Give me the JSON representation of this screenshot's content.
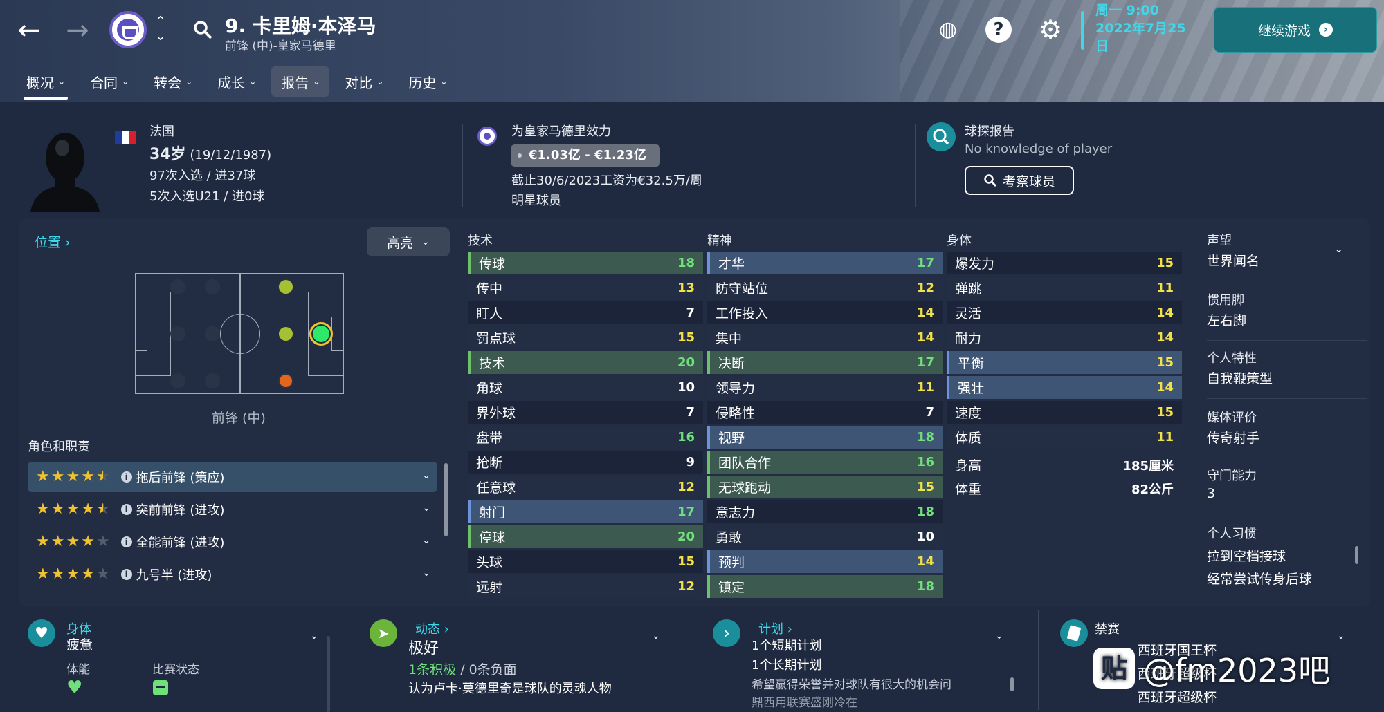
{
  "header": {
    "back_icon": "arrow-left-icon",
    "forward_icon": "arrow-right-icon",
    "player_name": "9. 卡里姆·本泽马",
    "player_sub": "前锋 (中)-皇家马德里",
    "date_day": "周一 9:00",
    "date_date": "2022年7月25",
    "date_suffix": "日",
    "continue_label": "继续游戏"
  },
  "tabs": [
    {
      "label": "概况"
    },
    {
      "label": "合同"
    },
    {
      "label": "转会"
    },
    {
      "label": "成长"
    },
    {
      "label": "报告"
    },
    {
      "label": "对比"
    },
    {
      "label": "历史"
    }
  ],
  "profile": {
    "nationality": "法国",
    "age": "34岁",
    "dob": "(19/12/1987)",
    "caps": "97次入选 / 进37球",
    "u21_caps": "5次入选U21 / 进0球",
    "club_status": "为皇家马德里效力",
    "value": "€1.03亿 - €1.23亿",
    "contract": "截止30/6/2023工资为€32.5万/周",
    "squad_status": "明星球员",
    "scout_title": "球探报告",
    "scout_text": "No knowledge of player",
    "scout_button": "考察球员",
    "flag_colors": [
      "#1f3e9c",
      "#ffffff",
      "#d6202c"
    ]
  },
  "position": {
    "link": "位置",
    "highlight": "高亮",
    "label": "前锋 (中)"
  },
  "roles": {
    "title": "角色和职责",
    "items": [
      {
        "stars": 4.5,
        "name": "拖后前锋 (策应)"
      },
      {
        "stars": 4.5,
        "name": "突前前锋 (进攻)"
      },
      {
        "stars": 4,
        "name": "全能前锋 (进攻)"
      },
      {
        "stars": 4,
        "name": "九号半 (进攻)"
      }
    ]
  },
  "attributes": {
    "technical": {
      "title": "技术",
      "items": [
        {
          "name": "传球",
          "value": "18",
          "hl": "g"
        },
        {
          "name": "传中",
          "value": "13",
          "hl": ""
        },
        {
          "name": "盯人",
          "value": "7",
          "hl": ""
        },
        {
          "name": "罚点球",
          "value": "15",
          "hl": ""
        },
        {
          "name": "技术",
          "value": "20",
          "hl": "g"
        },
        {
          "name": "角球",
          "value": "10",
          "hl": ""
        },
        {
          "name": "界外球",
          "value": "7",
          "hl": ""
        },
        {
          "name": "盘带",
          "value": "16",
          "hl": ""
        },
        {
          "name": "抢断",
          "value": "9",
          "hl": ""
        },
        {
          "name": "任意球",
          "value": "12",
          "hl": ""
        },
        {
          "name": "射门",
          "value": "17",
          "hl": "b"
        },
        {
          "name": "停球",
          "value": "20",
          "hl": "g"
        },
        {
          "name": "头球",
          "value": "15",
          "hl": ""
        },
        {
          "name": "远射",
          "value": "12",
          "hl": ""
        }
      ]
    },
    "mental": {
      "title": "精神",
      "items": [
        {
          "name": "才华",
          "value": "17",
          "hl": "b"
        },
        {
          "name": "防守站位",
          "value": "12",
          "hl": ""
        },
        {
          "name": "工作投入",
          "value": "14",
          "hl": ""
        },
        {
          "name": "集中",
          "value": "14",
          "hl": ""
        },
        {
          "name": "决断",
          "value": "17",
          "hl": "g"
        },
        {
          "name": "领导力",
          "value": "11",
          "hl": ""
        },
        {
          "name": "侵略性",
          "value": "7",
          "hl": ""
        },
        {
          "name": "视野",
          "value": "18",
          "hl": "b"
        },
        {
          "name": "团队合作",
          "value": "16",
          "hl": "g"
        },
        {
          "name": "无球跑动",
          "value": "15",
          "hl": "g"
        },
        {
          "name": "意志力",
          "value": "18",
          "hl": ""
        },
        {
          "name": "勇敢",
          "value": "10",
          "hl": ""
        },
        {
          "name": "预判",
          "value": "14",
          "hl": "b"
        },
        {
          "name": "镇定",
          "value": "18",
          "hl": "g"
        }
      ]
    },
    "physical": {
      "title": "身体",
      "items": [
        {
          "name": "爆发力",
          "value": "15",
          "hl": ""
        },
        {
          "name": "弹跳",
          "value": "11",
          "hl": ""
        },
        {
          "name": "灵活",
          "value": "14",
          "hl": ""
        },
        {
          "name": "耐力",
          "value": "14",
          "hl": ""
        },
        {
          "name": "平衡",
          "value": "15",
          "hl": "b"
        },
        {
          "name": "强壮",
          "value": "14",
          "hl": "b"
        },
        {
          "name": "速度",
          "value": "15",
          "hl": ""
        },
        {
          "name": "体质",
          "value": "11",
          "hl": ""
        }
      ],
      "height_label": "身高",
      "height_value": "185厘米",
      "weight_label": "体重",
      "weight_value": "82公斤"
    },
    "value_colors": {
      "high": "#6fe07a",
      "mid": "#f3e14a",
      "low": "#ffffff"
    }
  },
  "side_info": {
    "reputation_label": "声望",
    "reputation": "世界闻名",
    "foot_label": "惯用脚",
    "foot": "左右脚",
    "personality_label": "个人特性",
    "personality": "自我鞭策型",
    "media_label": "媒体评价",
    "media": "传奇射手",
    "gk_label": "守门能力",
    "gk": "3",
    "habits_label": "个人习惯",
    "habit1": "拉到空档接球",
    "habit2": "经常尝试传身后球"
  },
  "bottom": {
    "body_title": "身体",
    "body_status": "疲惫",
    "fitness_label": "体能",
    "match_label": "比赛状态",
    "dynamics_title": "动态",
    "dynamics_status": "极好",
    "dynamics_positive": "1条积极",
    "dynamics_sep": " / ",
    "dynamics_negative": "0条负面",
    "dynamics_note": "认为卢卡·莫德里奇是球队的灵魂人物",
    "plans_title": "计划",
    "plan_short": "1个短期计划",
    "plan_long": "1个长期计划",
    "plan_note": "希望赢得荣誉并对球队有很大的机会问",
    "plan_note2": "鼎西用联赛盛刚冷在",
    "ban_title": "禁赛",
    "ban1": "西班牙国王杯",
    "ban2": "西班牙超级杯",
    "ban3": "西班牙超级杯"
  },
  "watermark": {
    "logo_char": "贴",
    "text": "@fm2023吧"
  }
}
